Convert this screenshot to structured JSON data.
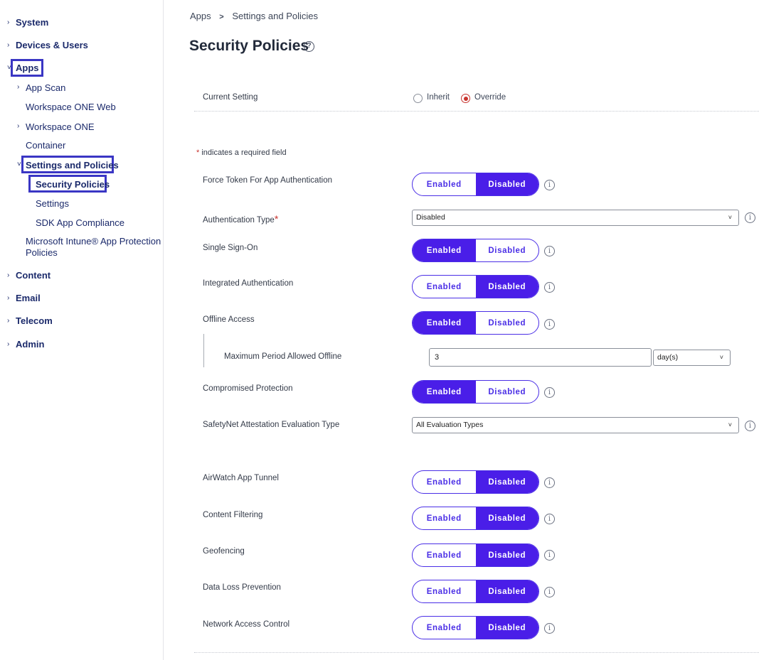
{
  "sidebar": {
    "system": "System",
    "devices": "Devices & Users",
    "apps": "Apps",
    "app_scan": "App Scan",
    "workspace_one_web": "Workspace ONE Web",
    "workspace_one": "Workspace ONE",
    "container": "Container",
    "settings_and_policies": "Settings and Policies",
    "security_policies": "Security Policies",
    "settings": "Settings",
    "sdk_app_compliance": "SDK App Compliance",
    "intune_line1": "Microsoft Intune® App Protection",
    "intune_line2": "Policies",
    "content": "Content",
    "email": "Email",
    "telecom": "Telecom",
    "admin": "Admin"
  },
  "breadcrumb": {
    "apps": "Apps",
    "sep": ">",
    "current": "Settings and Policies"
  },
  "page": {
    "title": "Security Policies",
    "help": "?"
  },
  "current_setting": {
    "label": "Current Setting",
    "inherit": "Inherit",
    "override": "Override",
    "selected": "Override"
  },
  "required_note": {
    "star": "*",
    "text": " indicates a required field"
  },
  "toggle_labels": {
    "enabled": "Enabled",
    "disabled": "Disabled"
  },
  "info_glyph": "i",
  "fields": {
    "force_token": {
      "label": "Force Token For App Authentication",
      "value": "Disabled"
    },
    "auth_type": {
      "label": "Authentication Type",
      "required": "*",
      "value": "Disabled"
    },
    "sso": {
      "label": "Single Sign-On",
      "value": "Enabled"
    },
    "integrated_auth": {
      "label": "Integrated Authentication",
      "value": "Disabled"
    },
    "offline_access": {
      "label": "Offline Access",
      "value": "Enabled"
    },
    "max_offline": {
      "label": "Maximum Period Allowed Offline",
      "value": "3",
      "unit": "day(s)"
    },
    "compromised": {
      "label": "Compromised Protection",
      "value": "Enabled"
    },
    "safetynet": {
      "label": "SafetyNet Attestation Evaluation Type",
      "value": "All Evaluation Types"
    },
    "app_tunnel": {
      "label": "AirWatch App Tunnel",
      "value": "Disabled"
    },
    "content_filtering": {
      "label": "Content Filtering",
      "value": "Disabled"
    },
    "geofencing": {
      "label": "Geofencing",
      "value": "Disabled"
    },
    "dlp": {
      "label": "Data Loss Prevention",
      "value": "Disabled"
    },
    "nac": {
      "label": "Network Access Control",
      "value": "Disabled"
    }
  },
  "colors": {
    "accent": "#4a1ee8",
    "nav_text": "#1b2a6b",
    "highlight_border": "#3a36c4",
    "required": "#c8332e"
  }
}
